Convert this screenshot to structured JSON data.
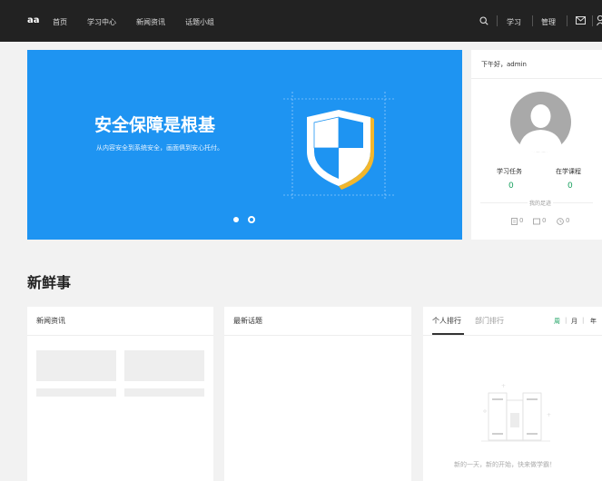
{
  "topbar": {
    "logo": "aa",
    "nav": [
      "首页",
      "学习中心",
      "新闻资讯",
      "话题小组"
    ],
    "study": "学习",
    "manage": "管理"
  },
  "banner": {
    "title": "安全保障是根基",
    "subtitle": "从内容安全到系统安全，画面俱到安心托付。",
    "slides": 2,
    "active_slide": 2
  },
  "user": {
    "greeting": "下午好，admin",
    "tasks_label": "学习任务",
    "tasks_value": "0",
    "courses_label": "在学课程",
    "courses_value": "0",
    "footprint_label": "我的足迹",
    "footprints": [
      "0",
      "0",
      "0"
    ]
  },
  "section": {
    "title": "新鲜事"
  },
  "panels": {
    "news": "新闻资讯",
    "topics": "最新话题",
    "ranking": {
      "tab_personal": "个人排行",
      "tab_department": "部门排行",
      "periods": [
        "周",
        "月",
        "年"
      ],
      "empty_text": "新的一天，新的开始，快来做学霸！"
    }
  },
  "colors": {
    "accent": "#1aa160",
    "banner": "#1e94f2",
    "topbar": "#222222"
  }
}
